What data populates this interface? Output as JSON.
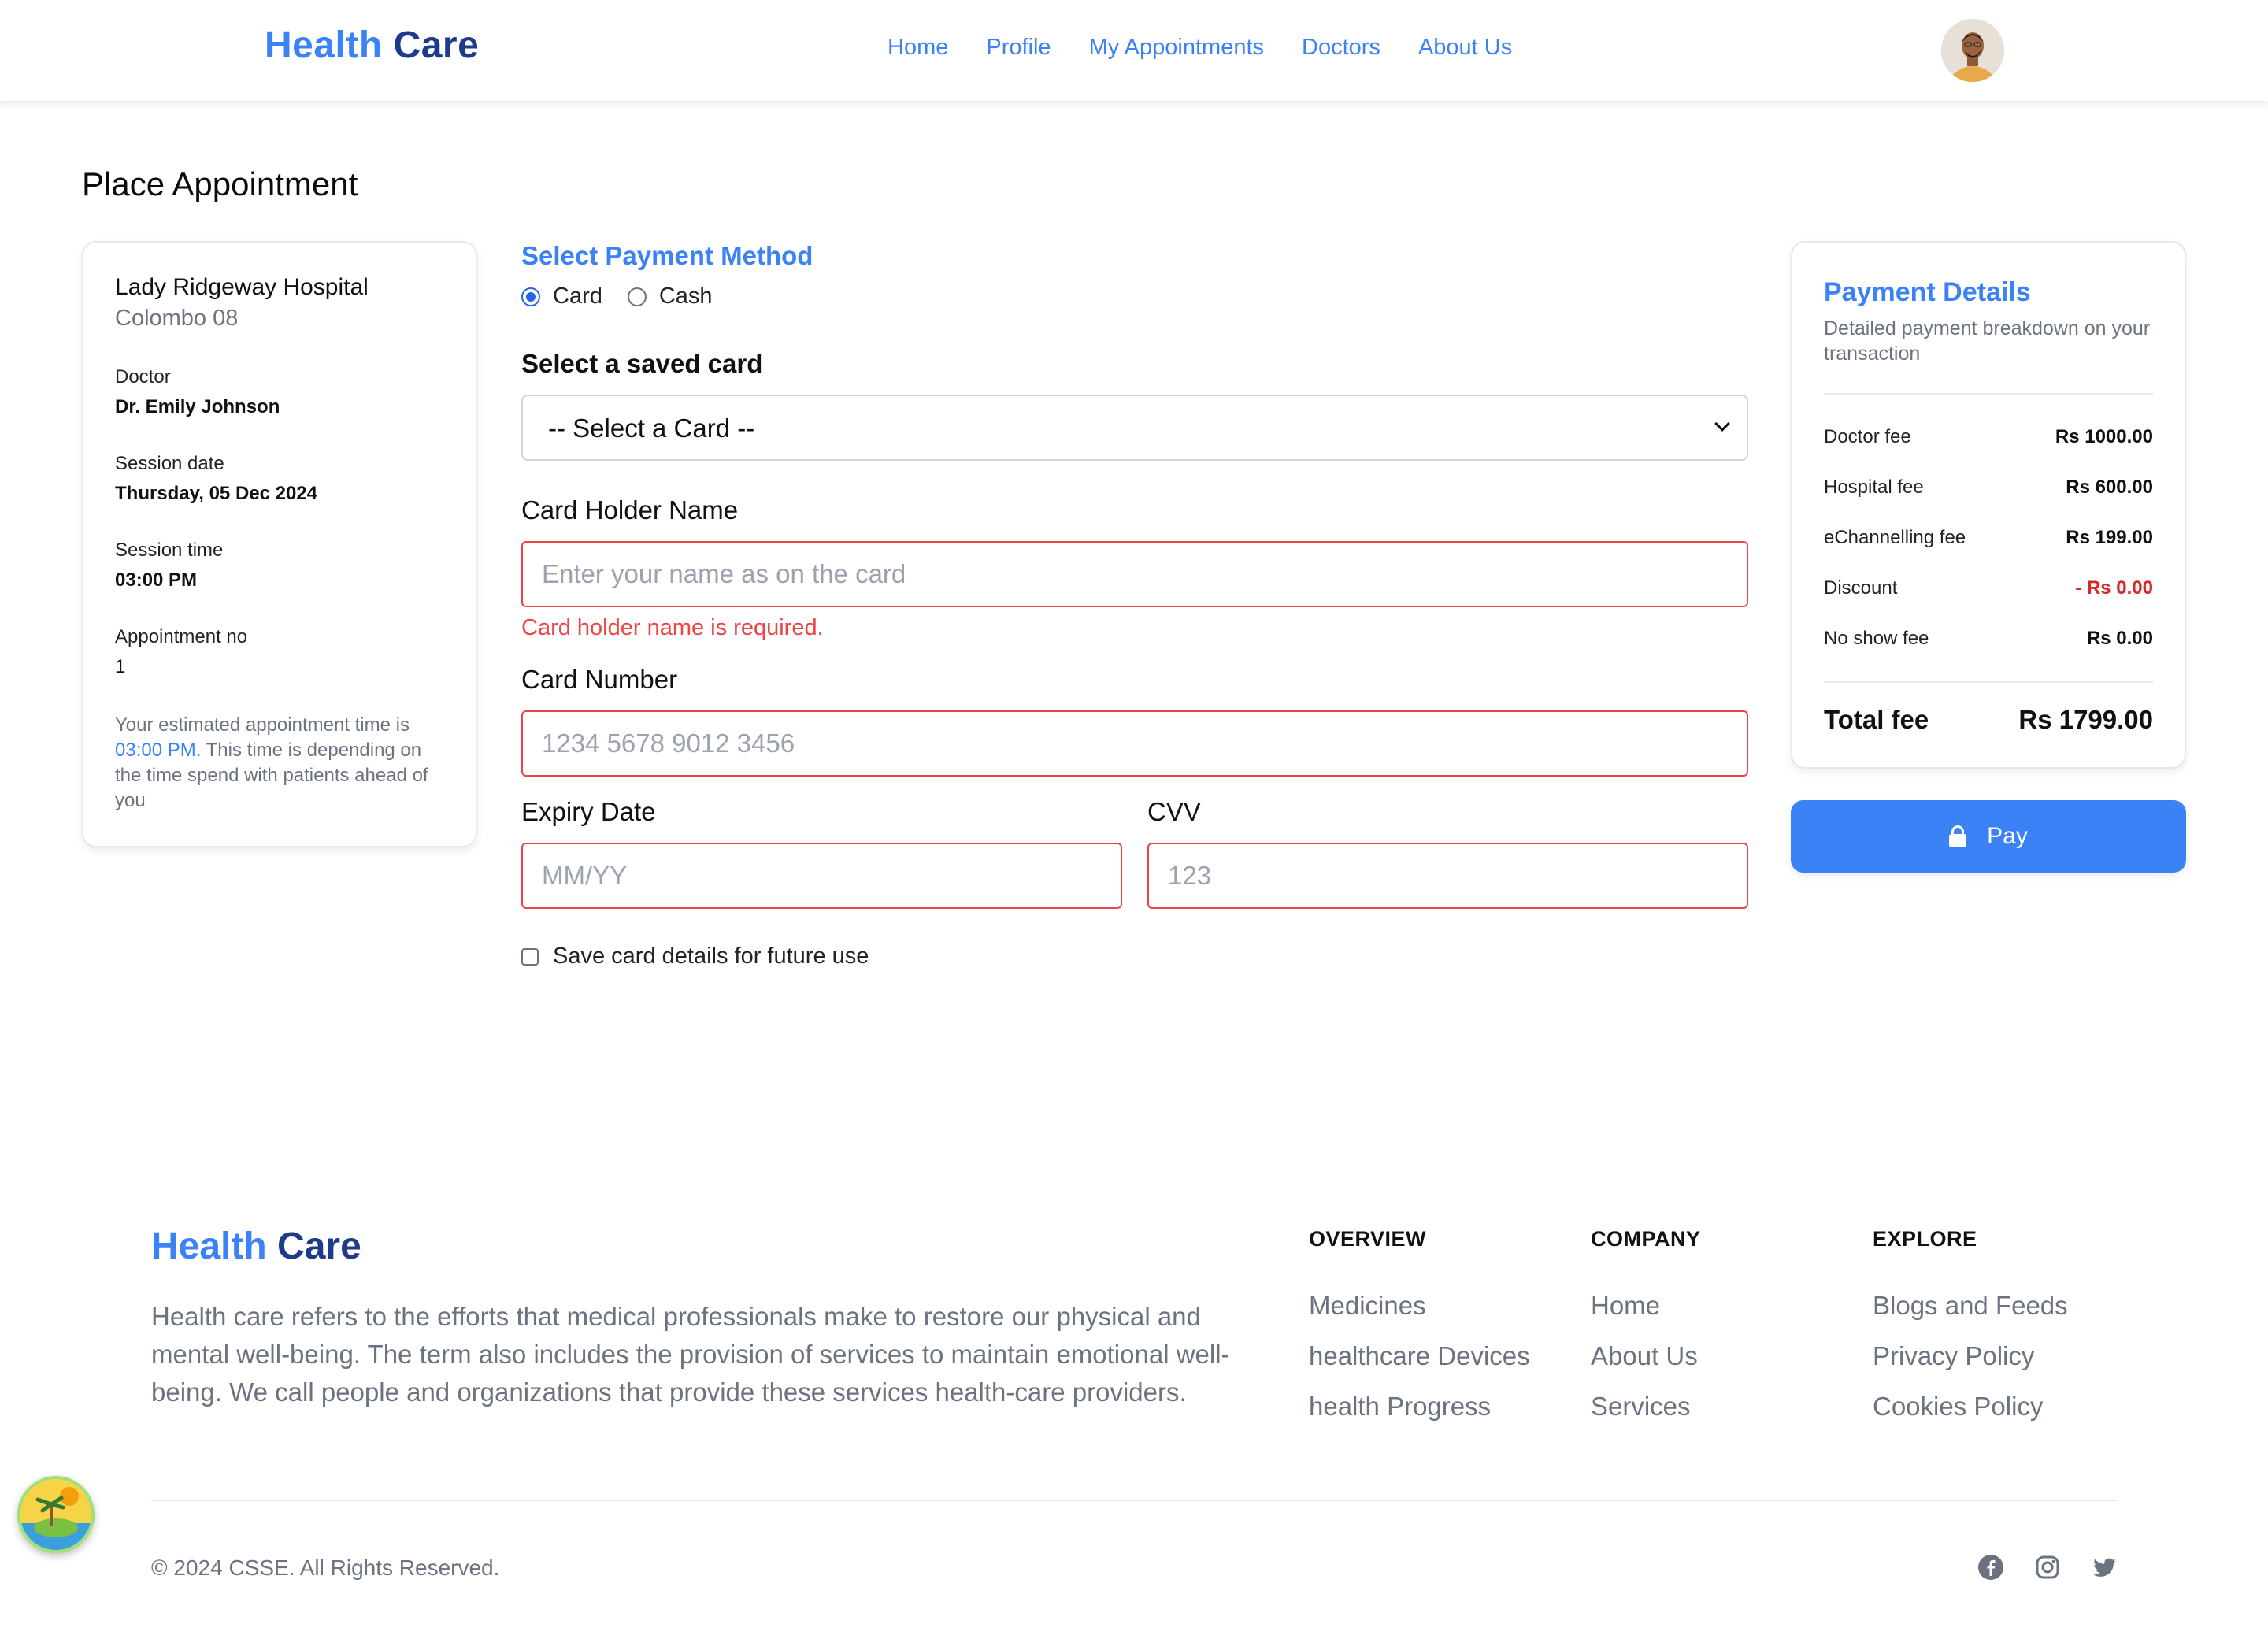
{
  "header": {
    "logo_part1": "Health",
    "logo_part2": "Care",
    "nav": [
      "Home",
      "Profile",
      "My Appointments",
      "Doctors",
      "About Us"
    ]
  },
  "page_title": "Place Appointment",
  "appointment": {
    "hospital": "Lady Ridgeway Hospital",
    "location": "Colombo 08",
    "doctor_label": "Doctor",
    "doctor": "Dr. Emily Johnson",
    "date_label": "Session date",
    "date": "Thursday, 05 Dec 2024",
    "time_label": "Session time",
    "time": "03:00 PM",
    "number_label": "Appointment no",
    "number": "1",
    "note_part1": "Your estimated appointment time is ",
    "note_time": "03:00 PM",
    "note_part2": ". This time is depending on the time spend with patients ahead of you"
  },
  "payment_form": {
    "method_title": "Select Payment Method",
    "method_card": "Card",
    "method_cash": "Cash",
    "selected_method": "Card",
    "saved_card_label": "Select a saved card",
    "saved_card_value": "-- Select a Card --",
    "holder_label": "Card Holder Name",
    "holder_placeholder": "Enter your name as on the card",
    "holder_error": "Card holder name is required.",
    "number_label": "Card Number",
    "number_placeholder": "1234 5678 9012 3456",
    "expiry_label": "Expiry Date",
    "expiry_placeholder": "MM/YY",
    "cvv_label": "CVV",
    "cvv_placeholder": "123",
    "save_label": "Save card details for future use"
  },
  "payment_details": {
    "title": "Payment Details",
    "subtitle": "Detailed payment breakdown on your transaction",
    "fees": [
      {
        "name": "Doctor fee",
        "value": "Rs 1000.00"
      },
      {
        "name": "Hospital fee",
        "value": "Rs 600.00"
      },
      {
        "name": "eChannelling fee",
        "value": "Rs 199.00"
      },
      {
        "name": "Discount",
        "value": "- Rs 0.00"
      },
      {
        "name": "No show fee",
        "value": "Rs 0.00"
      }
    ],
    "total_label": "Total fee",
    "total_value": "Rs 1799.00",
    "pay_label": "Pay"
  },
  "footer": {
    "logo_part1": "Health",
    "logo_part2": "Care",
    "description": "Health care refers to the efforts that medical professionals make to restore our physical and mental well-being. The term also includes the provision of services to maintain emotional well-being. We call people and organizations that provide these services health-care providers.",
    "columns": [
      {
        "title": "OVERVIEW",
        "links": [
          "Medicines",
          "healthcare Devices",
          "health Progress"
        ]
      },
      {
        "title": "COMPANY",
        "links": [
          "Home",
          "About Us",
          "Services"
        ]
      },
      {
        "title": "EXPLORE",
        "links": [
          "Blogs and Feeds",
          "Privacy Policy",
          "Cookies Policy"
        ]
      }
    ],
    "copyright": "© 2024 CSSE. All Rights Reserved.",
    "social_icons": [
      "facebook-icon",
      "instagram-icon",
      "twitter-icon"
    ]
  },
  "colors": {
    "primary": "#3b82f6",
    "dark_blue": "#1e3a8a",
    "error": "#ef4444",
    "discount": "#dc2626"
  }
}
